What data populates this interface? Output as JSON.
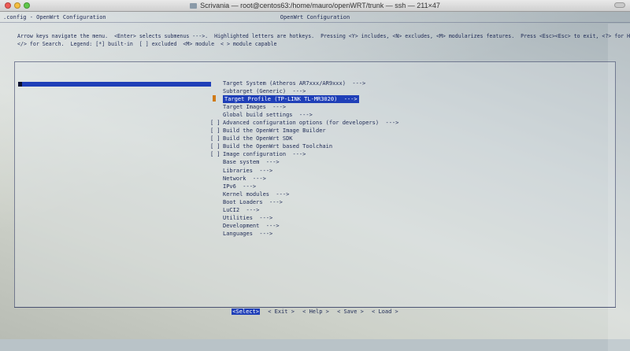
{
  "window": {
    "title": "Scrivania — root@centos63:/home/mauro/openWRT/trunk — ssh — 211×47"
  },
  "terminal": {
    "config_path": ".config - OpenWrt Configuration",
    "dialog_title": "OpenWrt Configuration",
    "help_line1": "Arrow keys navigate the menu.  <Enter> selects submenus --->.  Highlighted letters are hotkeys.  Pressing <Y> includes, <N> excludes, <M> modularizes features.  Press <Esc><Esc> to exit, <?> for Help,",
    "help_line2": "</> for Search.  Legend: [*] built-in  [ ] excluded  <M> module  < > module capable",
    "menu_items": [
      {
        "prefix": "",
        "label": "Target System (Atheros AR7xxx/AR9xxx)  --->",
        "selected": false
      },
      {
        "prefix": "",
        "label": "Subtarget (Generic)  --->",
        "selected": false
      },
      {
        "prefix": "",
        "label": "Target Profile (TP-LINK TL-MR3020)  --->",
        "selected": true
      },
      {
        "prefix": "",
        "label": "Target Images  --->",
        "selected": false
      },
      {
        "prefix": "",
        "label": "Global build settings  --->",
        "selected": false
      },
      {
        "prefix": "[ ]",
        "label": "Advanced configuration options (for developers)  --->",
        "selected": false
      },
      {
        "prefix": "[ ]",
        "label": "Build the OpenWrt Image Builder",
        "selected": false
      },
      {
        "prefix": "[ ]",
        "label": "Build the OpenWrt SDK",
        "selected": false
      },
      {
        "prefix": "[ ]",
        "label": "Build the OpenWrt based Toolchain",
        "selected": false
      },
      {
        "prefix": "[ ]",
        "label": "Image configuration  --->",
        "selected": false
      },
      {
        "prefix": "",
        "label": "Base system  --->",
        "selected": false
      },
      {
        "prefix": "",
        "label": "Libraries  --->",
        "selected": false
      },
      {
        "prefix": "",
        "label": "Network  --->",
        "selected": false
      },
      {
        "prefix": "",
        "label": "IPv6  --->",
        "selected": false
      },
      {
        "prefix": "",
        "label": "Kernel modules  --->",
        "selected": false
      },
      {
        "prefix": "",
        "label": "Boot Loaders  --->",
        "selected": false
      },
      {
        "prefix": "",
        "label": "LuCI2  --->",
        "selected": false
      },
      {
        "prefix": "",
        "label": "Utilities  --->",
        "selected": false
      },
      {
        "prefix": "",
        "label": "Development  --->",
        "selected": false
      },
      {
        "prefix": "",
        "label": "Languages  --->",
        "selected": false
      }
    ],
    "buttons": {
      "select": "<Select>",
      "exit": "< Exit >",
      "help": "< Help >",
      "save": "< Save >",
      "load": "< Load >"
    }
  }
}
